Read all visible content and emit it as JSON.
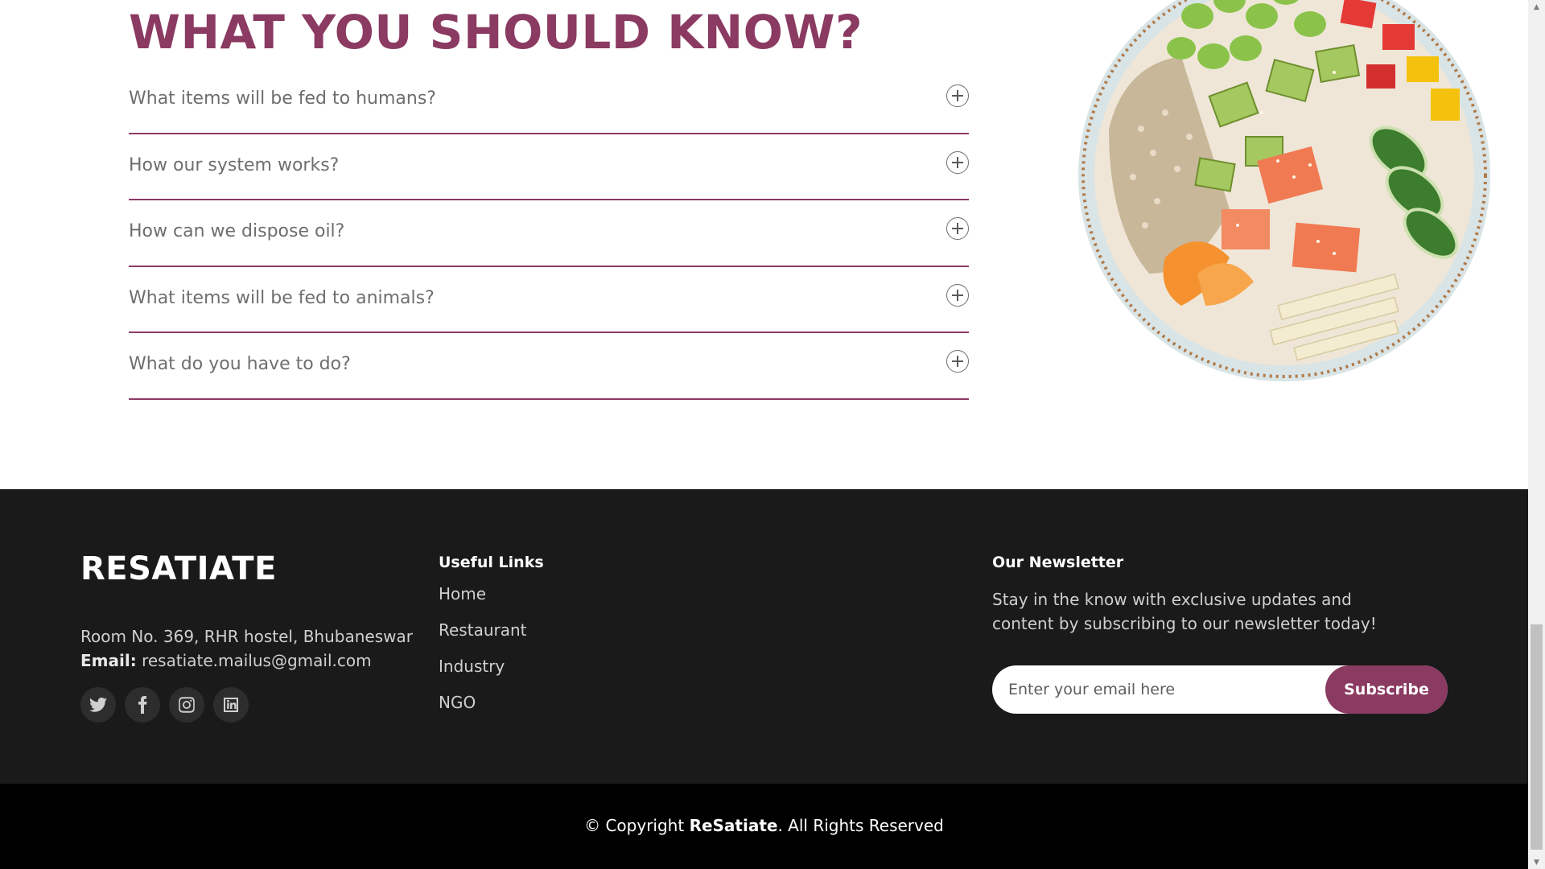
{
  "faq": {
    "title": "WHAT YOU SHOULD KNOW?",
    "questions": [
      "What items will be fed to humans?",
      "How our system works?",
      "How can we dispose oil?",
      "What items will be fed to animals?",
      "What do you have to do?"
    ],
    "icon": "plus-circle-icon",
    "accent_color": "#8b3a62"
  },
  "footer": {
    "brand": "RESATIATE",
    "address": "Room No. 369, RHR hostel, Bhubaneswar",
    "email_label": "Email:",
    "email": "resatiate.mailus@gmail.com",
    "socials": [
      "twitter-icon",
      "facebook-icon",
      "instagram-icon",
      "linkedin-icon"
    ],
    "useful_links_title": "Useful Links",
    "useful_links": [
      "Home",
      "Restaurant",
      "Industry",
      "NGO"
    ],
    "newsletter_title": "Our Newsletter",
    "newsletter_text": "Stay in the know with exclusive updates and content by subscribing to our newsletter today!",
    "email_placeholder": "Enter your email here",
    "subscribe_label": "Subscribe",
    "background_color": "#1b1a1b"
  },
  "copyright": {
    "prefix": "© Copyright ",
    "brand": "ReSatiate",
    "suffix": ". All Rights Reserved"
  }
}
